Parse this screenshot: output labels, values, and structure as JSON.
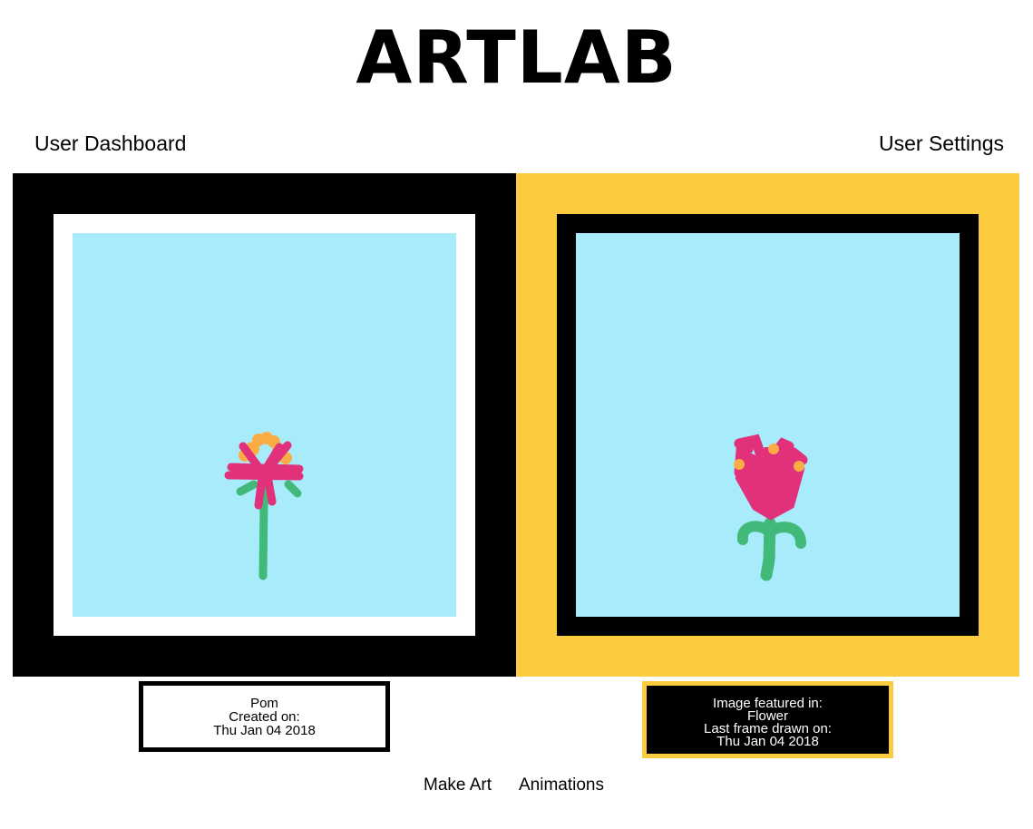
{
  "header": {
    "title": "ARTLAB"
  },
  "nav": {
    "dashboard": "User Dashboard",
    "settings": "User Settings"
  },
  "colors": {
    "sky": "#a8ecfc",
    "yellow": "#fdcb40",
    "pink": "#e0317a",
    "orange": "#fbad45",
    "green": "#41b97a"
  },
  "left_card": {
    "name": "Pom",
    "created_label": "Created on:",
    "date": "Thu Jan 04 2018"
  },
  "right_card": {
    "featured_label": "Image featured in:",
    "animation": "Flower",
    "last_frame_label": "Last frame drawn on:",
    "date": "Thu Jan 04 2018"
  },
  "footer": {
    "make_art": "Make Art",
    "animations": "Animations"
  }
}
